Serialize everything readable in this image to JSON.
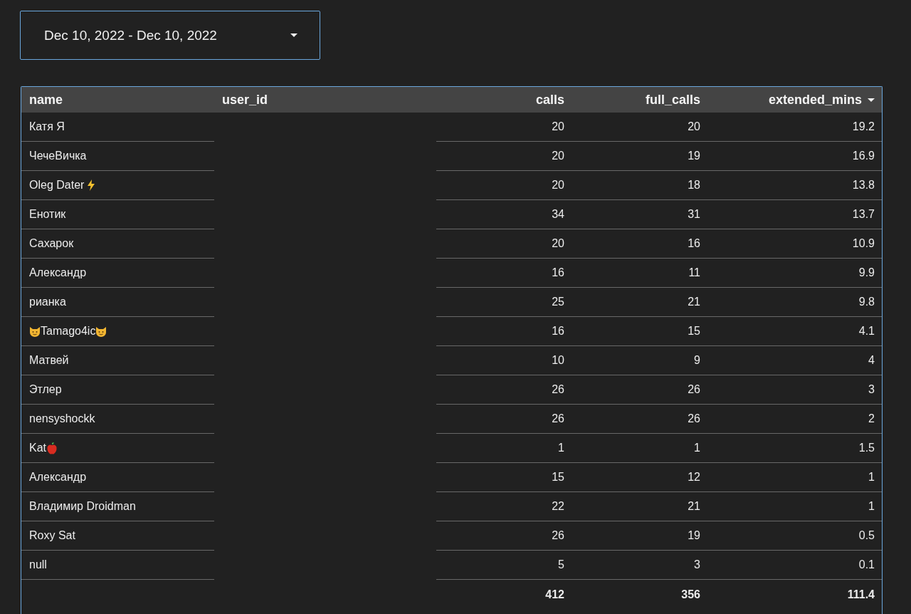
{
  "date_range": {
    "value": "Dec 10, 2022 - Dec 10, 2022"
  },
  "table": {
    "columns": [
      {
        "label": "name",
        "sorted": false
      },
      {
        "label": "user_id",
        "sorted": false
      },
      {
        "label": "calls",
        "sorted": false
      },
      {
        "label": "full_calls",
        "sorted": false
      },
      {
        "label": "extended_mins",
        "sorted": true
      }
    ],
    "rows": [
      {
        "name": [
          {
            "kind": "text",
            "text": "Катя Я"
          }
        ],
        "calls": "20",
        "full_calls": "20",
        "extended_mins": "19.2"
      },
      {
        "name": [
          {
            "kind": "text",
            "text": "ЧечеВичка"
          }
        ],
        "calls": "20",
        "full_calls": "19",
        "extended_mins": "16.9"
      },
      {
        "name": [
          {
            "kind": "text",
            "text": "Oleg Dater"
          },
          {
            "kind": "bolt"
          }
        ],
        "calls": "20",
        "full_calls": "18",
        "extended_mins": "13.8"
      },
      {
        "name": [
          {
            "kind": "text",
            "text": "Енотик"
          }
        ],
        "calls": "34",
        "full_calls": "31",
        "extended_mins": "13.7"
      },
      {
        "name": [
          {
            "kind": "text",
            "text": "Сахарок"
          }
        ],
        "calls": "20",
        "full_calls": "16",
        "extended_mins": "10.9"
      },
      {
        "name": [
          {
            "kind": "text",
            "text": "Александр"
          }
        ],
        "calls": "16",
        "full_calls": "11",
        "extended_mins": "9.9"
      },
      {
        "name": [
          {
            "kind": "text",
            "text": "рианка"
          }
        ],
        "calls": "25",
        "full_calls": "21",
        "extended_mins": "9.8"
      },
      {
        "name": [
          {
            "kind": "cat"
          },
          {
            "kind": "text",
            "text": "Tamago4ic"
          },
          {
            "kind": "cat"
          }
        ],
        "calls": "16",
        "full_calls": "15",
        "extended_mins": "4.1"
      },
      {
        "name": [
          {
            "kind": "text",
            "text": "Матвей"
          }
        ],
        "calls": "10",
        "full_calls": "9",
        "extended_mins": "4"
      },
      {
        "name": [
          {
            "kind": "text",
            "text": "Этлер"
          }
        ],
        "calls": "26",
        "full_calls": "26",
        "extended_mins": "3"
      },
      {
        "name": [
          {
            "kind": "text",
            "text": "nensyshockk"
          }
        ],
        "calls": "26",
        "full_calls": "26",
        "extended_mins": "2"
      },
      {
        "name": [
          {
            "kind": "text",
            "text": "Kat"
          },
          {
            "kind": "apple"
          }
        ],
        "calls": "1",
        "full_calls": "1",
        "extended_mins": "1.5"
      },
      {
        "name": [
          {
            "kind": "text",
            "text": "Александр"
          }
        ],
        "calls": "15",
        "full_calls": "12",
        "extended_mins": "1"
      },
      {
        "name": [
          {
            "kind": "text",
            "text": "Владимир Droidman"
          }
        ],
        "calls": "22",
        "full_calls": "21",
        "extended_mins": "1"
      },
      {
        "name": [
          {
            "kind": "text",
            "text": "Roxy Sat"
          }
        ],
        "calls": "26",
        "full_calls": "19",
        "extended_mins": "0.5"
      },
      {
        "name": [
          {
            "kind": "text",
            "text": "null"
          }
        ],
        "calls": "5",
        "full_calls": "3",
        "extended_mins": "0.1"
      }
    ],
    "totals": {
      "calls": "412",
      "full_calls": "356",
      "extended_mins": "111.4"
    }
  }
}
